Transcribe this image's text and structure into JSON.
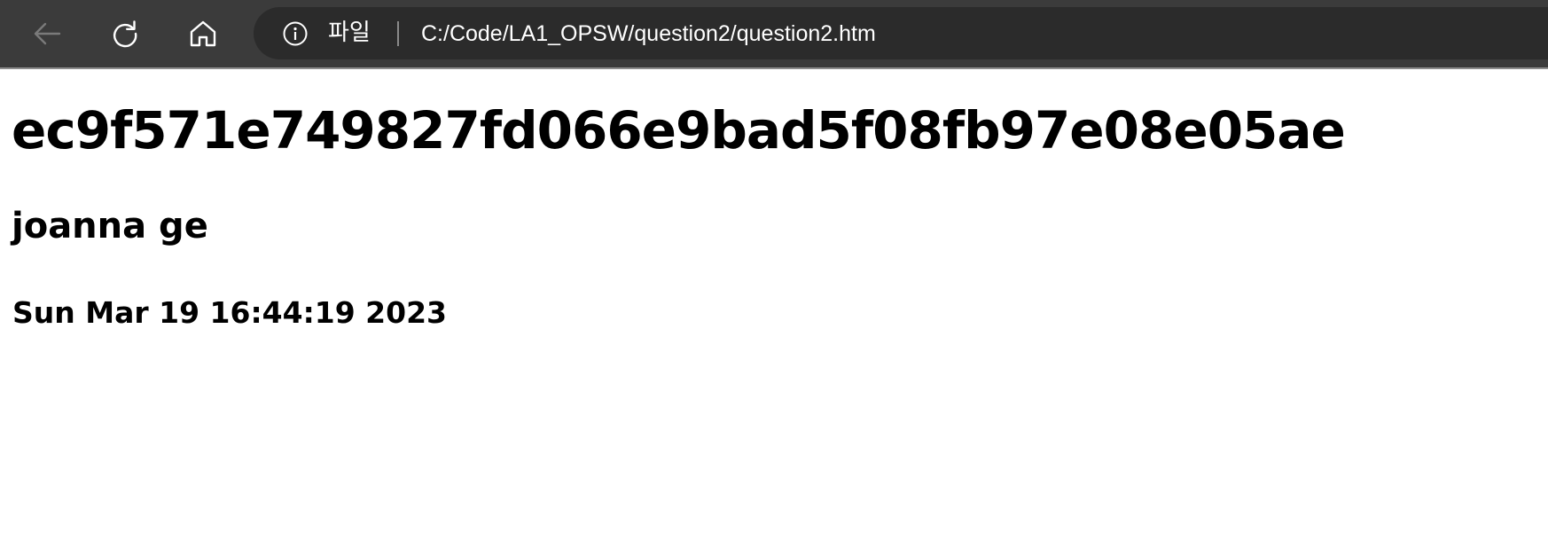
{
  "toolbar": {
    "back_icon": "arrow-left-icon",
    "refresh_icon": "refresh-icon",
    "home_icon": "home-icon",
    "address": {
      "info_icon": "info-icon",
      "site_label": "파일",
      "url": "C:/Code/LA1_OPSW/question2/question2.htm"
    },
    "colors": {
      "toolbar_bg": "#3b3b3b",
      "address_bg": "#2b2b2b",
      "text": "#ffffff",
      "back_disabled": "#7a7a7a"
    }
  },
  "page": {
    "hash_heading": "ec9f571e749827fd066e9bad5f08fb97e08e05ae",
    "name_heading": "joanna ge",
    "date_heading": "Sun Mar 19 16:44:19 2023"
  }
}
